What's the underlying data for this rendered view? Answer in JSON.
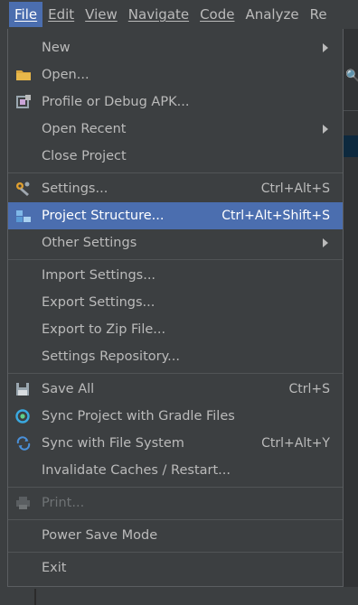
{
  "menubar": {
    "items": [
      {
        "label": "File",
        "active": true
      },
      {
        "label": "Edit"
      },
      {
        "label": "View"
      },
      {
        "label": "Navigate"
      },
      {
        "label": "Code"
      },
      {
        "label": "Analyze"
      },
      {
        "label": "Re"
      }
    ]
  },
  "file_menu": {
    "new": {
      "label": "New"
    },
    "open": {
      "label": "Open..."
    },
    "profile_debug_apk": {
      "label": "Profile or Debug APK..."
    },
    "open_recent": {
      "label": "Open Recent"
    },
    "close_project": {
      "label": "Close Project"
    },
    "settings": {
      "label": "Settings...",
      "shortcut": "Ctrl+Alt+S"
    },
    "project_structure": {
      "label": "Project Structure...",
      "shortcut": "Ctrl+Alt+Shift+S"
    },
    "other_settings": {
      "label": "Other Settings"
    },
    "import_settings": {
      "label": "Import Settings..."
    },
    "export_settings": {
      "label": "Export Settings..."
    },
    "export_zip": {
      "label": "Export to Zip File..."
    },
    "settings_repository": {
      "label": "Settings Repository..."
    },
    "save_all": {
      "label": "Save All",
      "shortcut": "Ctrl+S"
    },
    "sync_gradle": {
      "label": "Sync Project with Gradle Files"
    },
    "sync_fs": {
      "label": "Sync with File System",
      "shortcut": "Ctrl+Alt+Y"
    },
    "invalidate_caches": {
      "label": "Invalidate Caches / Restart..."
    },
    "print": {
      "label": "Print..."
    },
    "power_save": {
      "label": "Power Save Mode"
    },
    "exit": {
      "label": "Exit"
    }
  },
  "colors": {
    "menu_bg": "#3c3f41",
    "selection": "#4b6eaf",
    "text": "#bbbbbb",
    "disabled_text": "#6f7375"
  }
}
